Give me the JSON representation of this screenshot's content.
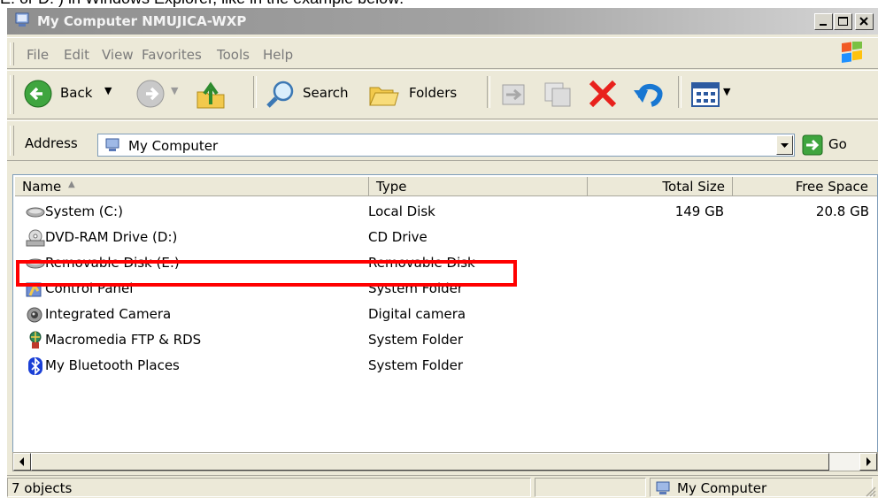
{
  "caption": "E: or D: ) in Windows Explorer, like in the example below:",
  "window": {
    "title": "My Computer NMUJICA-WXP",
    "title_icon": "computer-icon",
    "controls": [
      "minimize",
      "maximize",
      "close"
    ]
  },
  "menu": {
    "items": [
      "File",
      "Edit",
      "View",
      "Favorites",
      "Tools",
      "Help"
    ]
  },
  "toolbar": {
    "back_label": "Back",
    "search_label": "Search",
    "folders_label": "Folders",
    "icons": [
      "back-arrow-icon",
      "forward-arrow-icon",
      "up-folder-icon",
      "search-icon",
      "folders-icon",
      "move-to-icon",
      "copy-to-icon",
      "delete-icon",
      "undo-icon",
      "views-icon"
    ]
  },
  "address": {
    "label": "Address",
    "value": "My Computer",
    "go_label": "Go"
  },
  "columns": [
    "Name",
    "Type",
    "Total Size",
    "Free Space"
  ],
  "items": [
    {
      "name": "System (C:)",
      "type": "Local Disk",
      "total": "149 GB",
      "free": "20.8 GB",
      "icon": "hard-drive-icon"
    },
    {
      "name": "DVD-RAM Drive (D:)",
      "type": "CD Drive",
      "total": "",
      "free": "",
      "icon": "dvd-drive-icon"
    },
    {
      "name": "Removable Disk (E:)",
      "type": "Removable Disk",
      "total": "",
      "free": "",
      "icon": "removable-disk-icon"
    },
    {
      "name": "Control Panel",
      "type": "System Folder",
      "total": "",
      "free": "",
      "icon": "control-panel-icon"
    },
    {
      "name": "Integrated Camera",
      "type": "Digital camera",
      "total": "",
      "free": "",
      "icon": "camera-icon"
    },
    {
      "name": "Macromedia FTP & RDS",
      "type": "System Folder",
      "total": "",
      "free": "",
      "icon": "ftp-icon"
    },
    {
      "name": "My Bluetooth Places",
      "type": "System Folder",
      "total": "",
      "free": "",
      "icon": "bluetooth-icon"
    }
  ],
  "highlight_color": "#ff0000",
  "status": {
    "count": "7 objects",
    "location": "My Computer"
  }
}
